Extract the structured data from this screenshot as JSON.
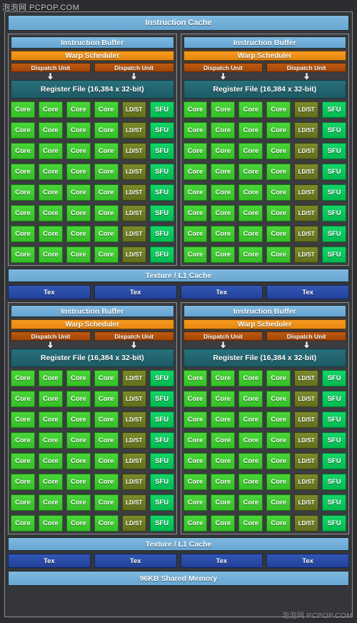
{
  "watermarks": {
    "top": "泡泡网 PCPOP.COM",
    "bottom": "泡泡网 PCPOP.COM"
  },
  "diagram": {
    "instruction_cache": "Instruction Cache",
    "shared_memory": "96KB Shared Memory",
    "texture_cache": "Texture / L1 Cache",
    "tex_label": "Tex",
    "tex_count": 4,
    "processing_block": {
      "instruction_buffer": "Instruction Buffer",
      "warp_scheduler": "Warp Scheduler",
      "dispatch_unit": "Dispatch Unit",
      "dispatch_count": 2,
      "register_file": "Register File (16,384 x 32-bit)",
      "core_label": "Core",
      "ldst_label": "LD/ST",
      "sfu_label": "SFU",
      "core_rows": 8,
      "cores_per_row": 4
    },
    "blocks_per_half": 2,
    "halves": 2
  },
  "colors": {
    "background": "#343639",
    "cache_blue": "#6fadd6",
    "warp_orange": "#ef8f18",
    "dispatch_brown": "#b05209",
    "register_teal": "#22636d",
    "core_green": "#3fcc2f",
    "ldst_olive": "#6f7d24",
    "sfu_emerald": "#0cc75c",
    "tex_blue": "#2a4aa8",
    "frame_gray": "#8d8f91"
  }
}
